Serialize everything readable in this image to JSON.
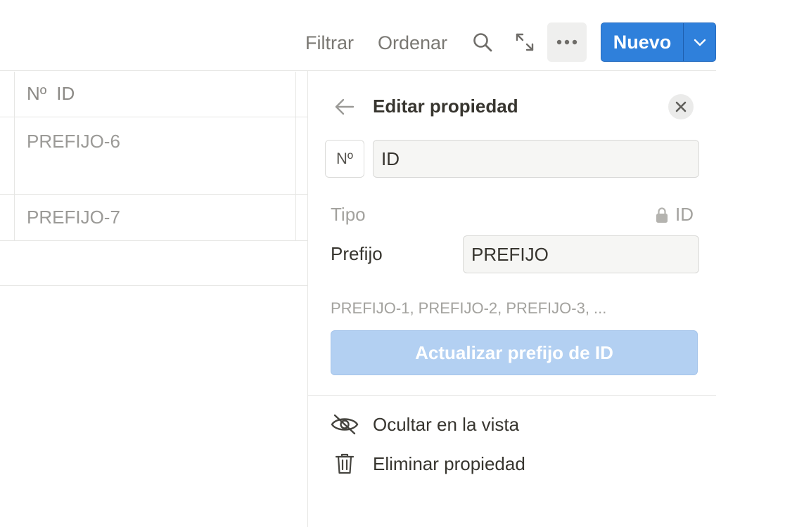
{
  "toolbar": {
    "filter_label": "Filtrar",
    "sort_label": "Ordenar",
    "search_icon": "search-icon",
    "expand_icon": "expand-icon",
    "more_icon": "more-icon",
    "new_label": "Nuevo",
    "new_dropdown_icon": "chevron-down-icon"
  },
  "table": {
    "column_icon": "Nº",
    "column_header": "ID",
    "rows": [
      {
        "id": "PREFIJO-6"
      },
      {
        "id": "PREFIJO-7"
      }
    ]
  },
  "panel": {
    "title": "Editar propiedad",
    "property_icon": "Nº",
    "property_name": "ID",
    "type_label": "Tipo",
    "type_value": "ID",
    "prefix_label": "Prefijo",
    "prefix_value": "PREFIJO",
    "prefix_preview": "PREFIJO-1, PREFIJO-2, PREFIJO-3, ...",
    "update_button": "Actualizar prefijo de ID",
    "hide_label": "Ocultar en la vista",
    "delete_label": "Eliminar propiedad"
  },
  "colors": {
    "accent": "#2f80db",
    "accent_disabled": "#b3d0f2",
    "muted_text": "#9b9a97",
    "border": "#e6e6e4"
  }
}
